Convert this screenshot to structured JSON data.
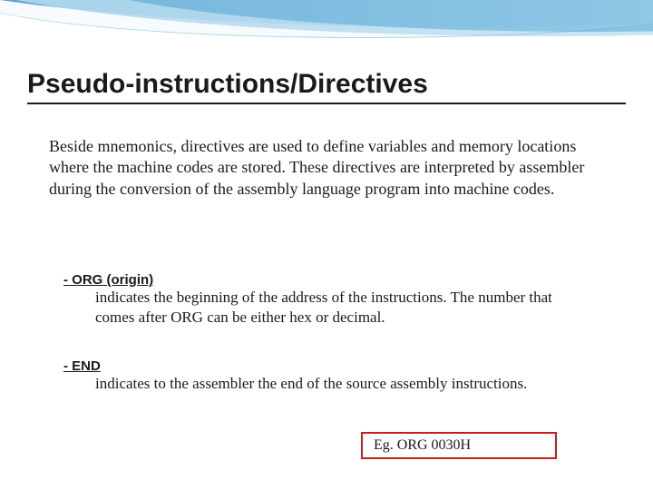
{
  "title": "Pseudo-instructions/Directives",
  "intro": "Beside mnemonics, directives are used to define variables and memory locations where the machine codes are stored. These directives are interpreted by assembler during the conversion of the assembly language program into machine codes.",
  "sections": [
    {
      "heading": "- ORG (origin)",
      "body": "indicates the beginning of the address of the instructions. The number that comes after ORG can be either hex or decimal."
    },
    {
      "heading": "- END",
      "body": "indicates to the assembler the end of the source assembly instructions."
    }
  ],
  "example": "Eg.   ORG   0030H"
}
